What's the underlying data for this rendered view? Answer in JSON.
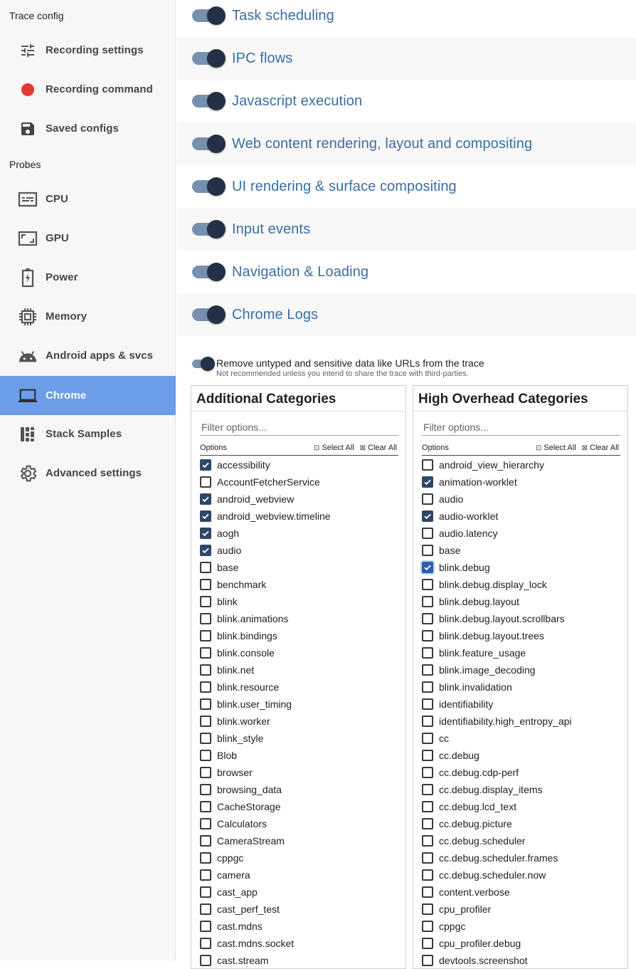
{
  "sidebar": {
    "trace_config_header": "Trace config",
    "trace_config_items": [
      {
        "label": "Recording settings",
        "icon": "tune-icon"
      },
      {
        "label": "Recording command",
        "icon": "record-dot-icon"
      },
      {
        "label": "Saved configs",
        "icon": "save-icon"
      }
    ],
    "probes_header": "Probes",
    "probe_items": [
      {
        "label": "CPU",
        "icon": "cpu-icon"
      },
      {
        "label": "GPU",
        "icon": "gpu-icon"
      },
      {
        "label": "Power",
        "icon": "battery-icon"
      },
      {
        "label": "Memory",
        "icon": "memory-chip-icon"
      },
      {
        "label": "Android apps & svcs",
        "icon": "android-icon"
      },
      {
        "label": "Chrome",
        "icon": "laptop-icon",
        "active": true
      },
      {
        "label": "Stack Samples",
        "icon": "stack-samples-icon"
      },
      {
        "label": "Advanced settings",
        "icon": "gear-icon"
      }
    ],
    "active_color": "#6b9de8",
    "record_color": "#e53935"
  },
  "main": {
    "probes": [
      {
        "label": "Task scheduling",
        "on": true
      },
      {
        "label": "IPC flows",
        "on": true
      },
      {
        "label": "Javascript execution",
        "on": true
      },
      {
        "label": "Web content rendering, layout and compositing",
        "on": true
      },
      {
        "label": "UI rendering & surface compositing",
        "on": true
      },
      {
        "label": "Input events",
        "on": true
      },
      {
        "label": "Navigation & Loading",
        "on": true
      },
      {
        "label": "Chrome Logs",
        "on": true
      }
    ],
    "privacy": {
      "title": "Remove untyped and sensitive data like URLs from the trace",
      "subtitle": "Not recommended unless you intend to share the trace with third-parties.",
      "on": true
    },
    "additional": {
      "title": "Additional Categories",
      "filter_placeholder": "Filter options...",
      "options_label": "Options",
      "select_all": "Select All",
      "clear_all": "Clear All",
      "items": [
        {
          "label": "accessibility",
          "checked": true
        },
        {
          "label": "AccountFetcherService",
          "checked": false
        },
        {
          "label": "android_webview",
          "checked": true
        },
        {
          "label": "android_webview.timeline",
          "checked": true
        },
        {
          "label": "aogh",
          "checked": true
        },
        {
          "label": "audio",
          "checked": true
        },
        {
          "label": "base",
          "checked": false
        },
        {
          "label": "benchmark",
          "checked": false
        },
        {
          "label": "blink",
          "checked": false
        },
        {
          "label": "blink.animations",
          "checked": false
        },
        {
          "label": "blink.bindings",
          "checked": false
        },
        {
          "label": "blink.console",
          "checked": false
        },
        {
          "label": "blink.net",
          "checked": false
        },
        {
          "label": "blink.resource",
          "checked": false
        },
        {
          "label": "blink.user_timing",
          "checked": false
        },
        {
          "label": "blink.worker",
          "checked": false
        },
        {
          "label": "blink_style",
          "checked": false
        },
        {
          "label": "Blob",
          "checked": false
        },
        {
          "label": "browser",
          "checked": false
        },
        {
          "label": "browsing_data",
          "checked": false
        },
        {
          "label": "CacheStorage",
          "checked": false
        },
        {
          "label": "Calculators",
          "checked": false
        },
        {
          "label": "CameraStream",
          "checked": false
        },
        {
          "label": "cppgc",
          "checked": false
        },
        {
          "label": "camera",
          "checked": false
        },
        {
          "label": "cast_app",
          "checked": false
        },
        {
          "label": "cast_perf_test",
          "checked": false
        },
        {
          "label": "cast.mdns",
          "checked": false
        },
        {
          "label": "cast.mdns.socket",
          "checked": false
        },
        {
          "label": "cast.stream",
          "checked": false
        }
      ]
    },
    "high_overhead": {
      "title": "High Overhead Categories",
      "filter_placeholder": "Filter options...",
      "options_label": "Options",
      "select_all": "Select All",
      "clear_all": "Clear All",
      "items": [
        {
          "label": "android_view_hierarchy",
          "checked": false
        },
        {
          "label": "animation-worklet",
          "checked": true
        },
        {
          "label": "audio",
          "checked": false
        },
        {
          "label": "audio-worklet",
          "checked": true
        },
        {
          "label": "audio.latency",
          "checked": false
        },
        {
          "label": "base",
          "checked": false
        },
        {
          "label": "blink.debug",
          "checked": true,
          "focused": true
        },
        {
          "label": "blink.debug.display_lock",
          "checked": false
        },
        {
          "label": "blink.debug.layout",
          "checked": false
        },
        {
          "label": "blink.debug.layout.scrollbars",
          "checked": false
        },
        {
          "label": "blink.debug.layout.trees",
          "checked": false
        },
        {
          "label": "blink.feature_usage",
          "checked": false
        },
        {
          "label": "blink.image_decoding",
          "checked": false
        },
        {
          "label": "blink.invalidation",
          "checked": false
        },
        {
          "label": "identifiability",
          "checked": false
        },
        {
          "label": "identifiability.high_entropy_api",
          "checked": false
        },
        {
          "label": "cc",
          "checked": false
        },
        {
          "label": "cc.debug",
          "checked": false
        },
        {
          "label": "cc.debug.cdp-perf",
          "checked": false
        },
        {
          "label": "cc.debug.display_items",
          "checked": false
        },
        {
          "label": "cc.debug.lcd_text",
          "checked": false
        },
        {
          "label": "cc.debug.picture",
          "checked": false
        },
        {
          "label": "cc.debug.scheduler",
          "checked": false
        },
        {
          "label": "cc.debug.scheduler.frames",
          "checked": false
        },
        {
          "label": "cc.debug.scheduler.now",
          "checked": false
        },
        {
          "label": "content.verbose",
          "checked": false
        },
        {
          "label": "cpu_profiler",
          "checked": false
        },
        {
          "label": "cppgc",
          "checked": false
        },
        {
          "label": "cpu_profiler.debug",
          "checked": false
        },
        {
          "label": "devtools.screenshot",
          "checked": false
        }
      ]
    }
  }
}
